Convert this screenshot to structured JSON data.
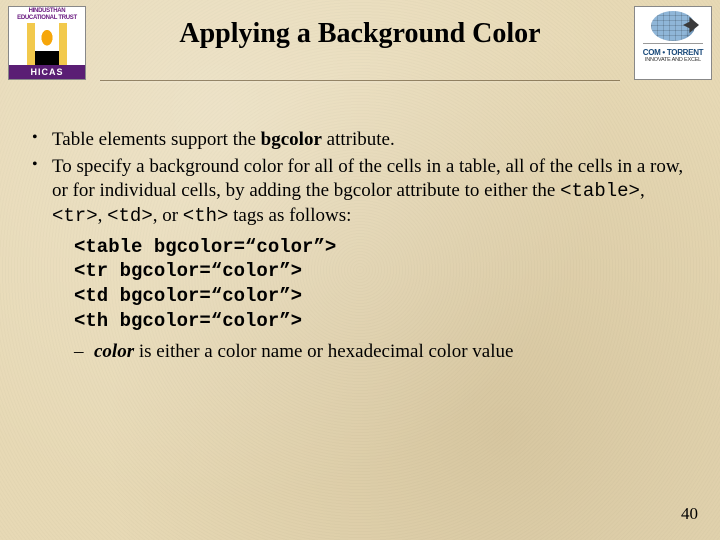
{
  "logoLeft": {
    "bannerLine": "HINDUSTHAN EDUCATIONAL TRUST",
    "footer": "HICAS"
  },
  "logoRight": {
    "line1": "COM • TORRENT",
    "line2": "INNOVATE AND EXCEL"
  },
  "title": "Applying a Background Color",
  "bullets": [
    {
      "pre": "Table elements support the ",
      "bold": "bgcolor",
      "post": " attribute."
    },
    {
      "pre": "To specify a background color for all of the cells in a table, all of the cells in a row, or for individual cells, by adding the bgcolor attribute to either the ",
      "tag1": "<table>",
      "sep1": ", ",
      "tag2": "<tr>",
      "sep2": ", ",
      "tag3": "<td>",
      "sep3": ", or ",
      "tag4": "<th>",
      "post": " tags as follows:"
    }
  ],
  "code": [
    "<table bgcolor=“color”>",
    "<tr bgcolor=“color”>",
    "<td bgcolor=“color”>",
    "<th bgcolor=“color”>"
  ],
  "dash": {
    "boldItalic": "color",
    "rest": " is either a color name or hexadecimal color value"
  },
  "pageNumber": "40"
}
